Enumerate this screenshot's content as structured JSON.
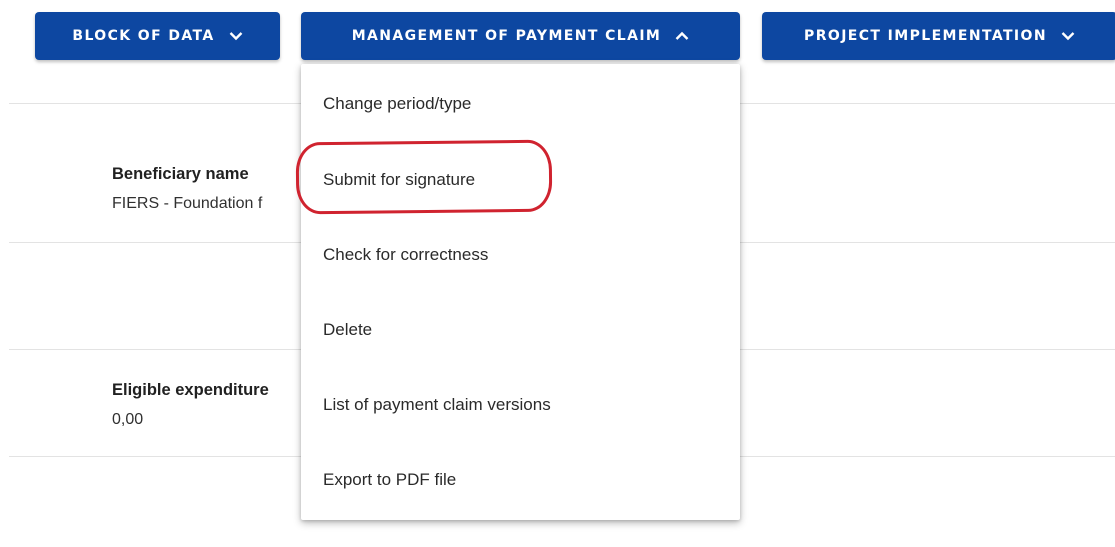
{
  "toolbar": {
    "block_of_data_label": "BLOCK OF DATA",
    "management_label": "MANAGEMENT OF PAYMENT CLAIM",
    "project_implementation_label": "PROJECT IMPLEMENTATION",
    "button_color": "#0d47a1"
  },
  "menu": {
    "items": [
      {
        "label": "Change period/type"
      },
      {
        "label": "Submit for signature"
      },
      {
        "label": "Check for correctness"
      },
      {
        "label": "Delete"
      },
      {
        "label": "List of payment claim versions"
      },
      {
        "label": "Export to PDF file"
      }
    ],
    "highlighted_item": "Submit for signature",
    "highlight_color": "#d0232f"
  },
  "fields": {
    "beneficiary": {
      "label": "Beneficiary name",
      "value": "FIERS - Foundation f"
    },
    "eligible": {
      "label": "Eligible expenditure",
      "value": "0,00"
    }
  },
  "icons": {
    "block_of_data": "chevron-down-icon",
    "management": "chevron-up-icon",
    "project_implementation": "chevron-down-icon"
  }
}
